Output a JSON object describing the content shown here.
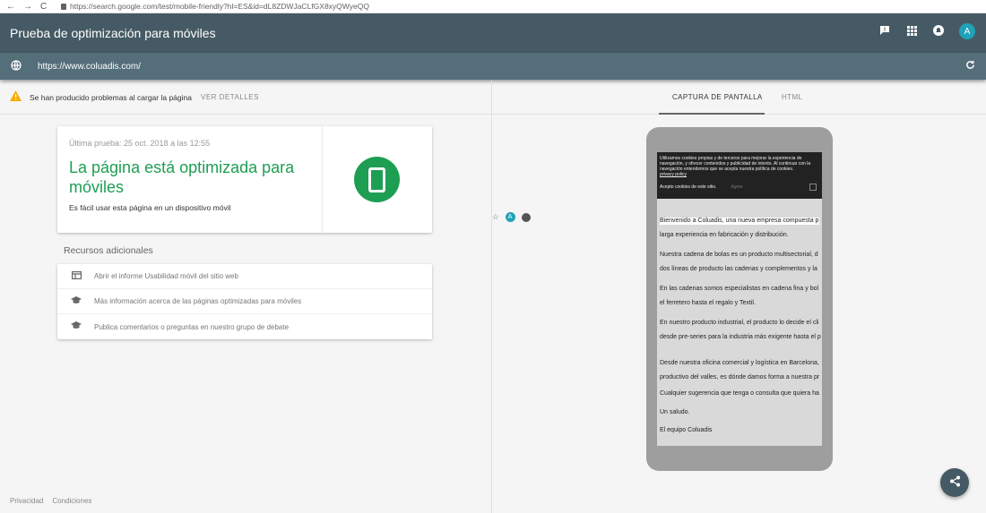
{
  "browser": {
    "back": "←",
    "forward": "→",
    "reload": "C",
    "url": "https://search.google.com/test/mobile-friendly?hl=ES&id=dL8ZDWJaCLfGX8xyQWyeQQ",
    "star": "☆",
    "avatar": "A",
    "ext": ""
  },
  "app": {
    "title": "Prueba de optimización para móviles",
    "avatar": "A"
  },
  "urlbar": {
    "url": "https://www.coluadis.com/"
  },
  "warning": {
    "text": "Se han producido problemas al cargar la página",
    "details": "VER DETALLES"
  },
  "result": {
    "last_test": "Última prueba: 25 oct. 2018 a las 12:55",
    "headline": "La página está optimizada para móviles",
    "subtitle": "Es fácil usar esta página en un dispositivo móvil"
  },
  "resources": {
    "title": "Recursos adicionales",
    "items": [
      {
        "label": "Abrir el informe Usabilidad móvil del sitio web",
        "icon": "web-icon"
      },
      {
        "label": "Más información acerca de las páginas optimizadas para móviles",
        "icon": "school-icon"
      },
      {
        "label": "Publica comentarios o preguntas en nuestro grupo de debate",
        "icon": "school-icon"
      }
    ]
  },
  "footer": {
    "privacy": "Privacidad",
    "terms": "Condiciones"
  },
  "tabs": {
    "screenshot": "CAPTURA DE PANTALLA",
    "html": "HTML"
  },
  "preview": {
    "cookie_text": "Utilizamos cookies propias y de terceros para mejorar la experiencia de navegación, y ofrecer contenidos y publicidad de interés. Al continuar con la navegación entendemos que se acepta nuestra política de cookies.",
    "cookie_link": "privacy policy",
    "cookie_accept": "Acepto cookies de este sitio.",
    "cookie_agree": "Agree",
    "lines": [
      "Bienvenido a Coluadis,  una nueva empresa compuesta p",
      " larga experiencia en fabricación y distribución.",
      "Nuestra cadena de bolas es un producto multisectorial, d",
      "dos líneas de producto las cadenas y complementos y la",
      "En las cadenas somos especialistas en cadena fina y bol",
      "el ferretero hasta el regalo y Textil.",
      "En nuestro producto industrial, el producto lo decide el cli",
      "desde pre-series para la industria más exigente hasta el p",
      "Desde nuestra oficina comercial y logística en Barcelona,",
      "productivo del valles, es dónde damos forma a nuestra pr",
      "Cualquier sugerencia que tenga o consulta que quiera ha",
      "Un saludo.",
      "El equipo Coluadis"
    ]
  },
  "colors": {
    "appbar": "#455a64",
    "urlbar": "#546e7a",
    "success": "#1e9e53",
    "warning": "#f9ab00"
  }
}
